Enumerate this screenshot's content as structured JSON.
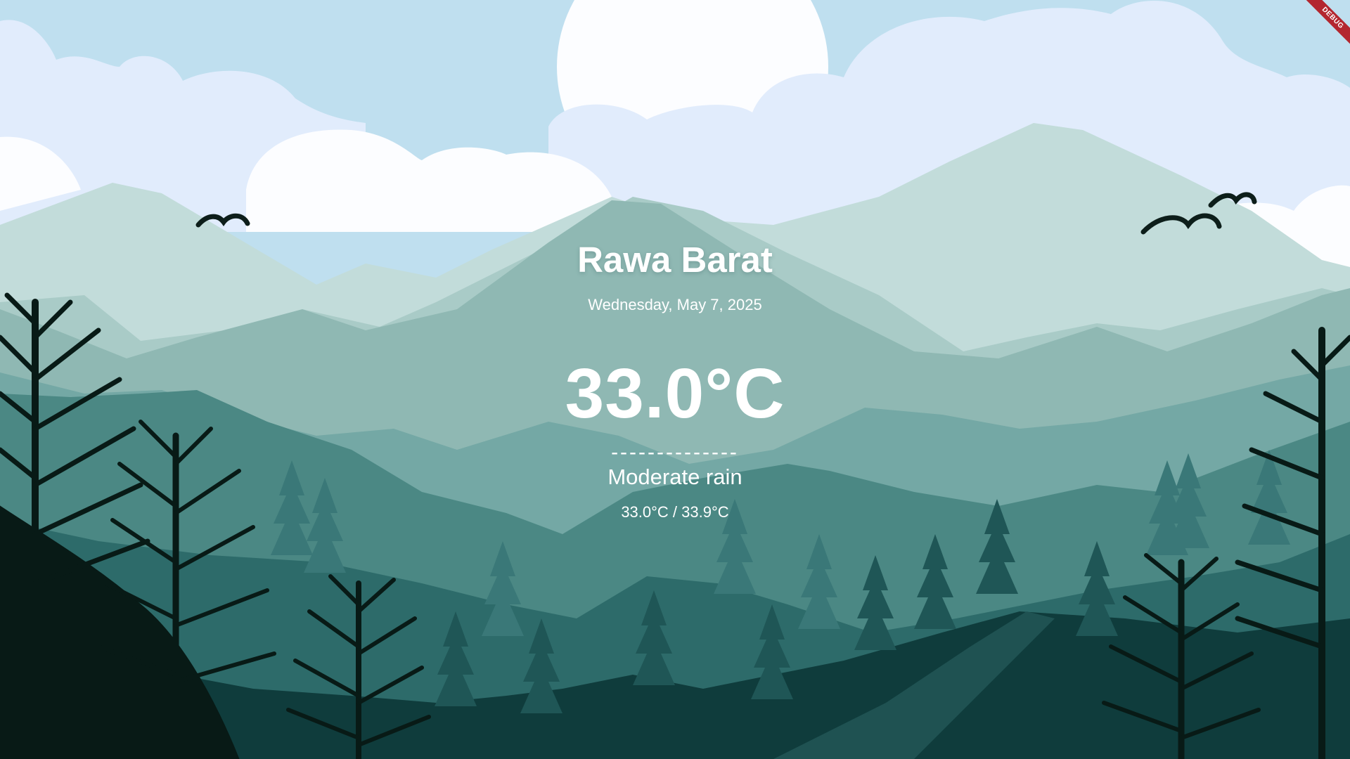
{
  "weather": {
    "city": "Rawa Barat",
    "date": "Wednesday, May 7, 2025",
    "temperature": "33.0°C",
    "divider": "--------------",
    "condition": "Moderate rain",
    "min_max": "33.0°C / 33.9°C"
  },
  "debug_banner": {
    "label": "DEBUG"
  },
  "background": {
    "scene": "mountain-landscape",
    "colors": {
      "sky": "#bfdfef",
      "cloud": "#e1ecfc",
      "sun": "#fcfdff",
      "far_mountains": "#c2dcda",
      "mid_mountains": "#8fb8b3",
      "near_mountains": "#4b8884",
      "foreground": "#0f3c3c",
      "tree_silhouette": "#081a16",
      "banner": "#b3262f"
    }
  }
}
